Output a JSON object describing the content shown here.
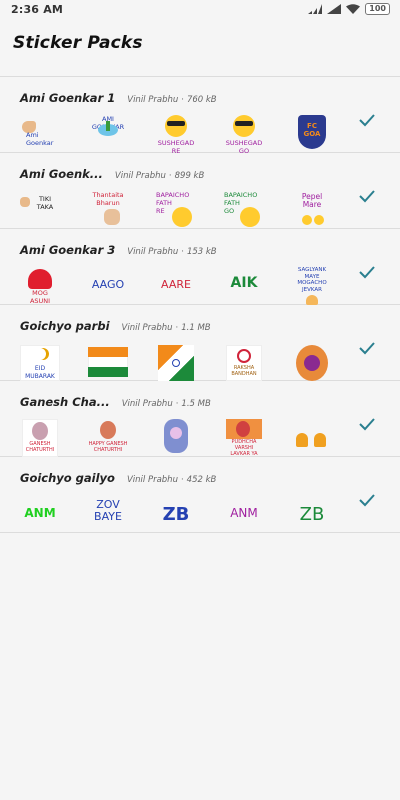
{
  "status": {
    "time": "2:36 AM",
    "battery": "100"
  },
  "header": {
    "title": "Sticker Packs"
  },
  "packs": [
    {
      "name": "Ami Goenkar 1",
      "author": "Vinil Prabhu",
      "size": "760 kB",
      "stickers": [
        {
          "icon": "hand-icon",
          "text": "Ami\nGoenkar"
        },
        {
          "icon": "palm-tree-icon",
          "text": "AMI\nGOENKAR"
        },
        {
          "icon": "sunglasses-face-icon",
          "text": "SUSHEGAD\nRE"
        },
        {
          "icon": "sunglasses-face-icon",
          "text": "SUSHEGAD\nGO"
        },
        {
          "icon": "fc-goa-logo-icon",
          "text": "FC\nGOA"
        }
      ]
    },
    {
      "name": "Ami Goenk...",
      "author": "Vinil Prabhu",
      "size": "899 kB",
      "stickers": [
        {
          "icon": "fist-bump-icon",
          "text": "TIKI\nTAKA"
        },
        {
          "icon": "hand-icon",
          "text": "Thantaita\nBharun"
        },
        {
          "icon": "rolling-eyes-face-icon",
          "text": "BAPAICHO\nFATH\nRE"
        },
        {
          "icon": "rolling-eyes-face-icon",
          "text": "BAPAICHO\nFATH\nGO"
        },
        {
          "icon": "heart-eyes-face-icon",
          "text": "Pepel\nMare"
        }
      ]
    },
    {
      "name": "Ami Goenkar 3",
      "author": "Vinil Prabhu",
      "size": "153 kB",
      "stickers": [
        {
          "icon": "heart-icon",
          "text": "MOG\nASUNI"
        },
        {
          "icon": "text-sticker-icon",
          "text": "AAGO"
        },
        {
          "icon": "text-sticker-icon",
          "text": "AARE"
        },
        {
          "icon": "text-sticker-icon",
          "text": "AIK"
        },
        {
          "icon": "praying-hands-icon",
          "text": "SAGLYANK\nMAYE\nMOGACHO\nJEVKAR"
        }
      ]
    },
    {
      "name": "Goichyo parbi",
      "author": "Vinil Prabhu",
      "size": "1.1 MB",
      "stickers": [
        {
          "icon": "crescent-moon-icon",
          "text": "EID\nMUBARAK"
        },
        {
          "icon": "flag-banner-icon",
          "text": ""
        },
        {
          "icon": "india-flag-icon",
          "text": ""
        },
        {
          "icon": "rakhi-icon",
          "text": "RAKSHA\nBANDHAN"
        },
        {
          "icon": "rakhi-hand-icon",
          "text": ""
        }
      ]
    },
    {
      "name": "Ganesh Cha...",
      "author": "Vinil Prabhu",
      "size": "1.5 MB",
      "stickers": [
        {
          "icon": "ganesh-icon",
          "text": "GANESH\nCHATURTHI"
        },
        {
          "icon": "ganesh-icon",
          "text": "HAPPY GANESH\nCHATURTHI"
        },
        {
          "icon": "ganesh-icon",
          "text": ""
        },
        {
          "icon": "ganesh-icon",
          "text": "PUDHCHA\nVARSHI\nLAVKAR YA"
        },
        {
          "icon": "diya-lamps-icon",
          "text": ""
        }
      ]
    },
    {
      "name": "Goichyo gailyo",
      "author": "Vinil Prabhu",
      "size": "452 kB",
      "stickers": [
        {
          "icon": "text-sticker-icon",
          "text": "ANM"
        },
        {
          "icon": "text-sticker-icon",
          "text": "ZOV\nBAYE"
        },
        {
          "icon": "text-sticker-icon",
          "text": "ZB"
        },
        {
          "icon": "text-sticker-icon",
          "text": "ANM"
        },
        {
          "icon": "text-sticker-icon",
          "text": "ZB"
        }
      ]
    }
  ],
  "colors": {
    "check": "#2a7f8f",
    "background": "#f5f5f5"
  }
}
